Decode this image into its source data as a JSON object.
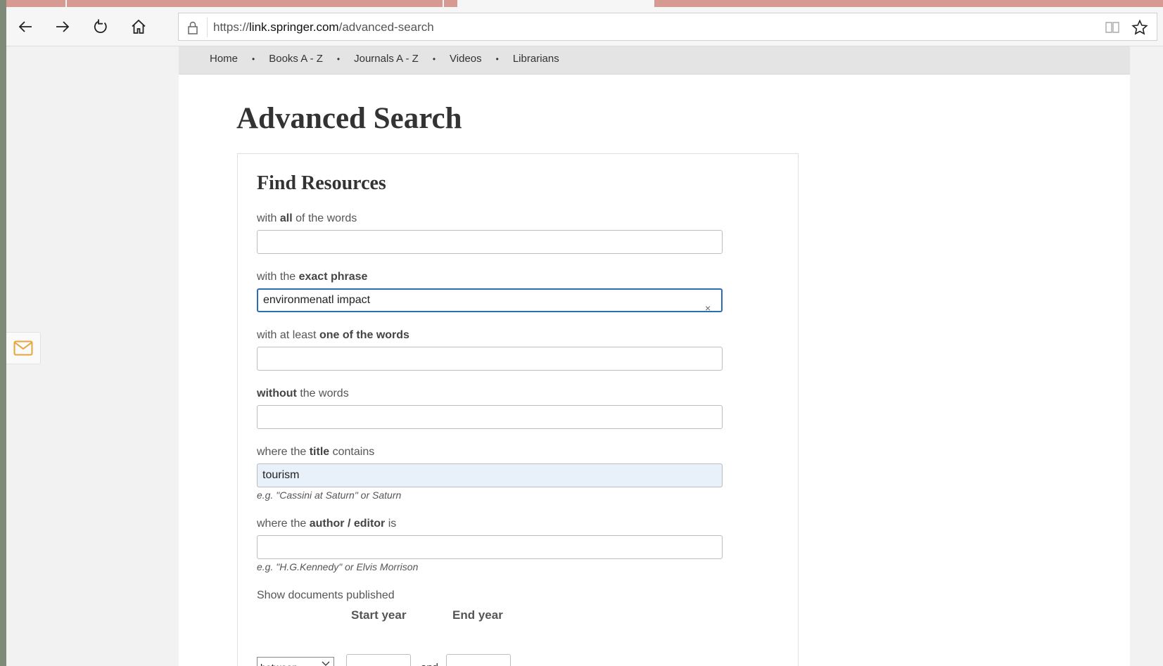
{
  "browser": {
    "url_prefix": "https://",
    "url_domain": "link.springer.com",
    "url_path": "/advanced-search"
  },
  "nav": {
    "items": [
      "Home",
      "Books A - Z",
      "Journals A - Z",
      "Videos",
      "Librarians"
    ],
    "separator": "•"
  },
  "page": {
    "title": "Advanced Search"
  },
  "form": {
    "title": "Find Resources",
    "all_words": {
      "pre": "with ",
      "bold": "all",
      "post": " of the words",
      "value": ""
    },
    "exact_phrase": {
      "pre": "with the ",
      "bold": "exact phrase",
      "post": "",
      "value": "environmenatl impact"
    },
    "one_of_words": {
      "pre": "with at least ",
      "bold": "one of the words",
      "post": "",
      "value": ""
    },
    "without_words": {
      "pre": "",
      "bold": "without",
      "post": " the words",
      "value": ""
    },
    "title_contains": {
      "pre": "where the ",
      "bold": "title",
      "post": " contains",
      "value": "tourism",
      "hint": "e.g. \"Cassini at Saturn\" or Saturn"
    },
    "author": {
      "pre": "where the ",
      "bold": "author / editor",
      "post": " is",
      "value": "",
      "hint": "e.g. \"H.G.Kennedy\" or Elvis Morrison"
    },
    "date": {
      "label": "Show documents published",
      "start_label": "Start year",
      "end_label": "End year",
      "mode": "between",
      "and": "and",
      "start_value": "",
      "end_value": ""
    },
    "clear_symbol": "×"
  },
  "colors": {
    "focus_border": "#2a6ebb",
    "autofill_bg": "#e8f0fa",
    "feedback_icon": "#e8a33a"
  }
}
